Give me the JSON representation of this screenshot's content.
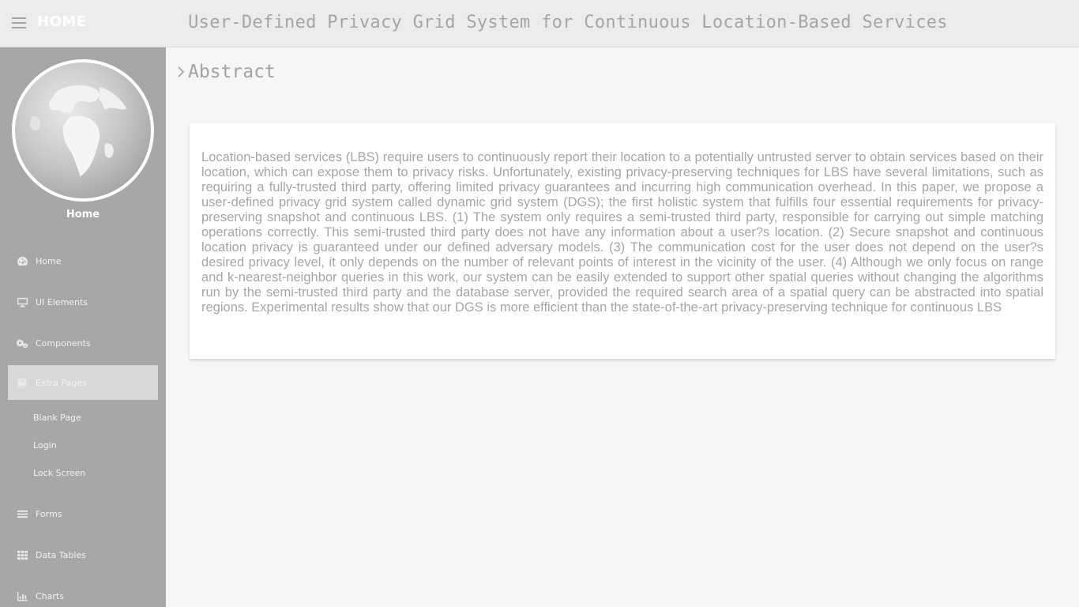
{
  "header": {
    "brand": "HOME",
    "title": "User-Defined Privacy Grid System for Continuous Location-Based Services"
  },
  "sidebar": {
    "profile_name": "Home",
    "items": [
      {
        "label": "Home",
        "icon": "dashboard-icon"
      },
      {
        "label": "UI Elements",
        "icon": "desktop-icon"
      },
      {
        "label": "Components",
        "icon": "cogs-icon"
      },
      {
        "label": "Extra Pages",
        "icon": "book-icon",
        "active": true
      },
      {
        "label": "Forms",
        "icon": "list-icon"
      },
      {
        "label": "Data Tables",
        "icon": "table-icon"
      },
      {
        "label": "Charts",
        "icon": "chart-icon"
      }
    ],
    "sub_items": [
      {
        "label": "Blank Page"
      },
      {
        "label": "Login"
      },
      {
        "label": "Lock Screen"
      }
    ]
  },
  "main": {
    "breadcrumb": "Abstract",
    "abstract": "Location-based services (LBS) require users to continuously report their location to a potentially untrusted server to obtain services based on their location, which can expose them to privacy risks. Unfortunately, existing privacy-preserving techniques for LBS have several limitations, such as requiring a fully-trusted third party, offering limited privacy guarantees and incurring high communication overhead. In this paper, we propose a user-defined privacy grid system called dynamic grid system (DGS); the first holistic system that fulfills four essential requirements for privacy-preserving snapshot and continuous LBS. (1) The system only requires a semi-trusted third party, responsible for carrying out simple matching operations correctly. This semi-trusted third party does not have any information about a user?s location. (2) Secure snapshot and continuous location privacy is guaranteed under our defined adversary models. (3) The communication cost for the user does not depend on the user?s desired privacy level, it only depends on the number of relevant points of interest in the vicinity of the user. (4) Although we only focus on range and k-nearest-neighbor queries in this work, our system can be easily extended to support other spatial queries without changing the algorithms run by the semi-trusted third party and the database server, provided the required search area of a spatial query can be abstracted into spatial regions. Experimental results show that our DGS is more efficient than the state-of-the-art privacy-preserving technique for continuous LBS"
  },
  "colors": {
    "sidebar_bg": "#a7a7a7",
    "active_item_bg": "#d8d8d8",
    "topbar_bg": "#ececec",
    "text_muted": "#a6a6a6"
  }
}
